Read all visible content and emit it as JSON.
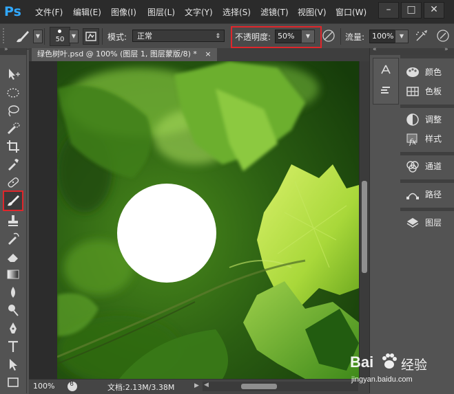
{
  "app": {
    "logo_text": "Ps",
    "menu": [
      "文件(F)",
      "编辑(E)",
      "图像(I)",
      "图层(L)",
      "文字(Y)",
      "选择(S)",
      "滤镜(T)",
      "视图(V)",
      "窗口(W)"
    ],
    "window_controls": {
      "minimize": "–",
      "restore": "□",
      "close": "✕"
    }
  },
  "options_bar": {
    "brush_size": "50",
    "mode_label": "模式:",
    "mode_value": "正常",
    "opacity_label": "不透明度:",
    "opacity_value": "50%",
    "flow_label": "流量:",
    "flow_value": "100%",
    "highlight_color": "#e0262b"
  },
  "document": {
    "tab_title": "绿色树叶.psd @ 100% (图层 1, 图层蒙版/8) *",
    "tab_close": "×"
  },
  "toolbar": {
    "tools": [
      "move-tool",
      "marquee-tool",
      "lasso-tool",
      "quick-select-tool",
      "crop-tool",
      "eyedropper-tool",
      "healing-brush-tool",
      "brush-tool",
      "clone-stamp-tool",
      "history-brush-tool",
      "eraser-tool",
      "gradient-tool",
      "blur-tool",
      "dodge-tool",
      "pen-tool",
      "type-tool",
      "path-select-tool",
      "rectangle-tool"
    ],
    "selected_tool": "brush-tool"
  },
  "status_bar": {
    "zoom": "100%",
    "doc_info": "文档:2.13M/3.38M"
  },
  "right_panel": {
    "groups": [
      [
        {
          "label": "颜色",
          "icon": "palette-icon"
        },
        {
          "label": "色板",
          "icon": "swatches-icon"
        }
      ],
      [
        {
          "label": "调整",
          "icon": "adjustments-icon"
        },
        {
          "label": "样式",
          "icon": "styles-fx-icon"
        }
      ],
      [
        {
          "label": "通道",
          "icon": "channels-icon"
        }
      ],
      [
        {
          "label": "路径",
          "icon": "paths-icon"
        }
      ],
      [
        {
          "label": "图层",
          "icon": "layers-icon"
        }
      ]
    ]
  },
  "watermark": {
    "brand": "Bai",
    "brand_suffix": "经验",
    "url": "jingyan.baidu.com"
  }
}
